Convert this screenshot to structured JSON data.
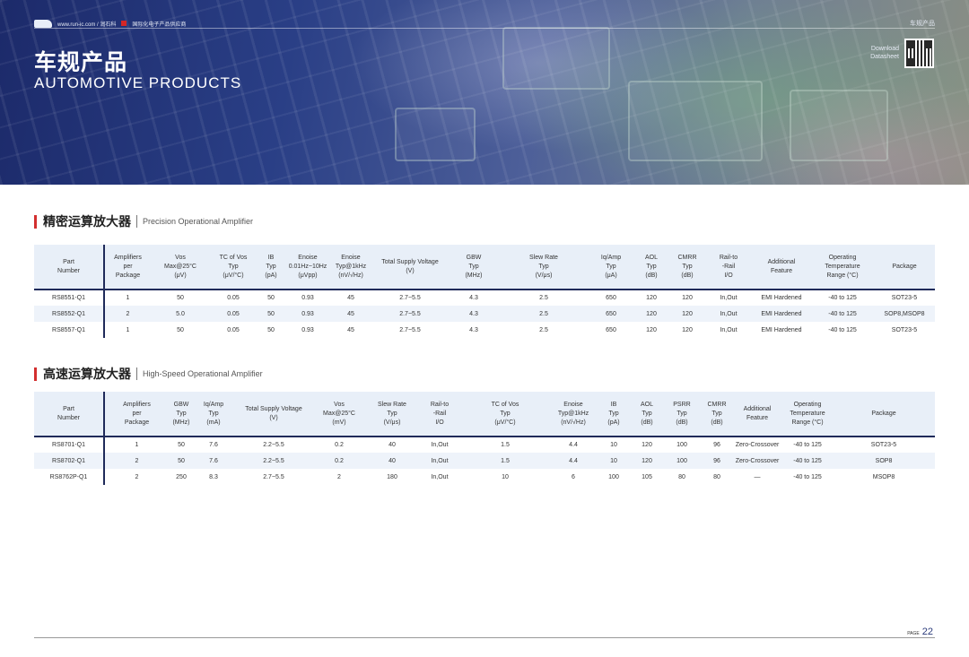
{
  "header": {
    "url_text": "www.run-ic.com /  润石科",
    "tagline": "国际化电子产品供应商",
    "section_label": "车规产品",
    "title_zh": "车规产品",
    "title_en": "AUTOMOTIVE PRODUCTS",
    "download_line1": "Download",
    "download_line2": "Datasheet"
  },
  "precision": {
    "title_zh": "精密运算放大器",
    "title_en": "Precision Operational Amplifier",
    "headers": [
      "Part\nNumber",
      "Amplifiers\nper\nPackage",
      "Vos\nMax@25°C\n(μV)",
      "TC of Vos\nTyp\n(μV/°C)",
      "IB\nTyp\n(pA)",
      "Enoise\n0.01Hz~10Hz\n(μVpp)",
      "Enoise\nTyp@1kHz\n(nV/√Hz)",
      "Total Supply Voltage\n(V)",
      "GBW\nTyp\n(MHz)",
      "Slew Rate\nTyp\n(V/μs)",
      "Iq/Amp\nTyp\n(μA)",
      "AOL\nTyp\n(dB)",
      "CMRR\nTyp\n(dB)",
      "Rail-to\n-Rail\nI/O",
      "Additional\nFeature",
      "Operating\nTemperature\nRange (°C)",
      "Package"
    ],
    "rows": [
      [
        "RS8551-Q1",
        "1",
        "50",
        "0.05",
        "50",
        "0.93",
        "45",
        "2.7~5.5",
        "4.3",
        "2.5",
        "650",
        "120",
        "120",
        "In,Out",
        "EMI Hardened",
        "-40 to 125",
        "SOT23-5"
      ],
      [
        "RS8552-Q1",
        "2",
        "5.0",
        "0.05",
        "50",
        "0.93",
        "45",
        "2.7~5.5",
        "4.3",
        "2.5",
        "650",
        "120",
        "120",
        "In,Out",
        "EMI Hardened",
        "-40 to 125",
        "SOP8,MSOP8"
      ],
      [
        "RS8557-Q1",
        "1",
        "50",
        "0.05",
        "50",
        "0.93",
        "45",
        "2.7~5.5",
        "4.3",
        "2.5",
        "650",
        "120",
        "120",
        "In,Out",
        "EMI Hardened",
        "-40 to 125",
        "SOT23-5"
      ]
    ]
  },
  "highspeed": {
    "title_zh": "高速运算放大器",
    "title_en": "High-Speed Operational Amplifier",
    "headers": [
      "Part\nNumber",
      "Amplifiers\nper\nPackage",
      "GBW\nTyp\n(MHz)",
      "Iq/Amp\nTyp\n(mA)",
      "Total Supply Voltage\n(V)",
      "Vos\nMax@25°C\n(mV)",
      "Slew Rate\nTyp\n(V/μs)",
      "Rail-to\n-Rail\nI/O",
      "TC of Vos\nTyp\n(μV/°C)",
      "Enoise\nTyp@1kHz\n(nV/√Hz)",
      "IB\nTyp\n(pA)",
      "AOL\nTyp\n(dB)",
      "PSRR\nTyp\n(dB)",
      "CMRR\nTyp\n(dB)",
      "Additional\nFeature",
      "Operating\nTemperature\nRange (°C)",
      "Package"
    ],
    "rows": [
      [
        "RS8701-Q1",
        "1",
        "50",
        "7.6",
        "2.2~5.5",
        "0.2",
        "40",
        "In,Out",
        "1.5",
        "4.4",
        "10",
        "120",
        "100",
        "96",
        "Zero-Crossover",
        "-40 to 125",
        "SOT23-5"
      ],
      [
        "RS8702-Q1",
        "2",
        "50",
        "7.6",
        "2.2~5.5",
        "0.2",
        "40",
        "In,Out",
        "1.5",
        "4.4",
        "10",
        "120",
        "100",
        "96",
        "Zero-Crossover",
        "-40 to 125",
        "SOP8"
      ],
      [
        "RS8762P-Q1",
        "2",
        "250",
        "8.3",
        "2.7~5.5",
        "2",
        "180",
        "In,Out",
        "10",
        "6",
        "100",
        "105",
        "80",
        "80",
        "—",
        "-40 to 125",
        "MSOP8"
      ]
    ]
  },
  "footer": {
    "page_label": "PAGE",
    "page_number": "22"
  }
}
